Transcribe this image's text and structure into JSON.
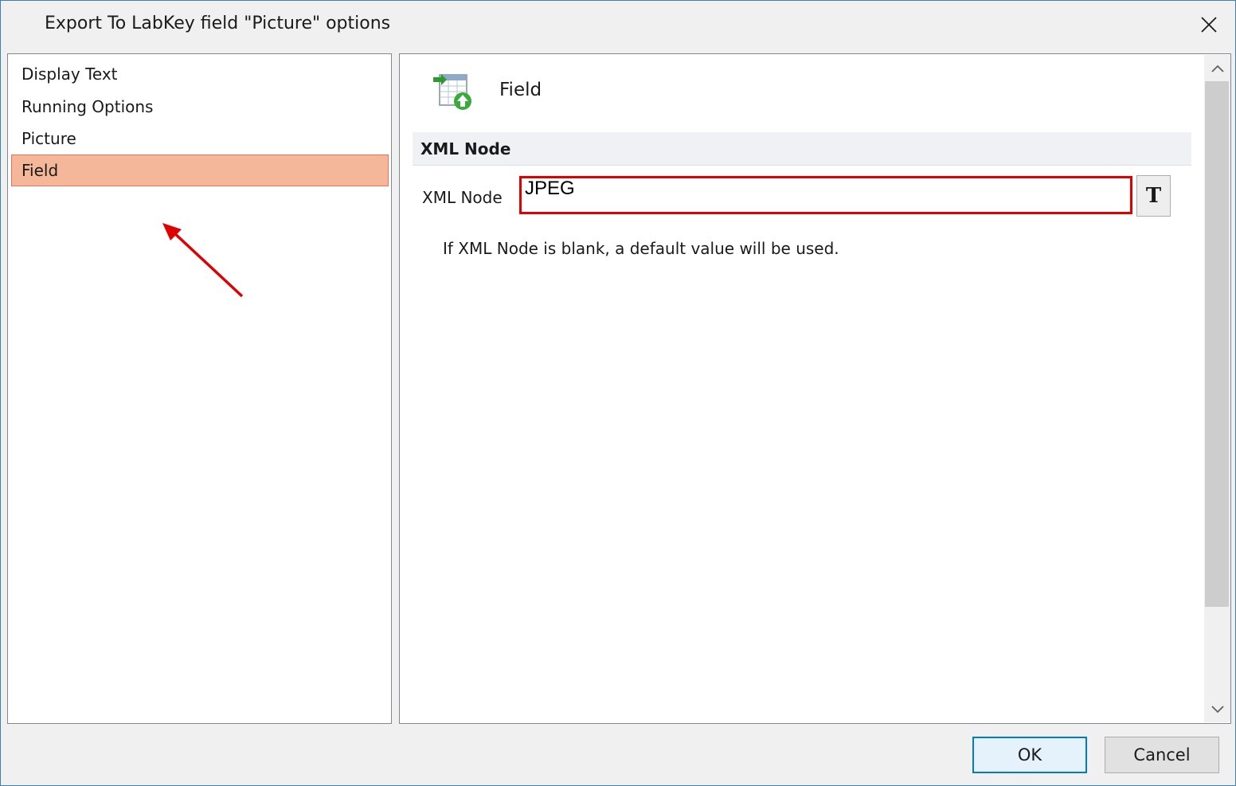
{
  "window": {
    "title": "Export To LabKey field \"Picture\" options"
  },
  "sidebar": {
    "items": [
      {
        "label": "Display Text",
        "selected": false
      },
      {
        "label": "Running Options",
        "selected": false
      },
      {
        "label": "Picture",
        "selected": false
      },
      {
        "label": "Field",
        "selected": true
      }
    ]
  },
  "content": {
    "heading": "Field",
    "icon": "export-table-icon",
    "section_title": "XML Node",
    "xml_node_label": "XML Node",
    "xml_node_value": "JPEG",
    "text_button_label": "T",
    "hint": "If XML Node is blank, a default value will be used."
  },
  "buttons": {
    "ok": "OK",
    "cancel": "Cancel"
  },
  "colors": {
    "selected_bg": "#f5b79a",
    "highlight_border": "#e00000",
    "accent": "#0078d7"
  }
}
